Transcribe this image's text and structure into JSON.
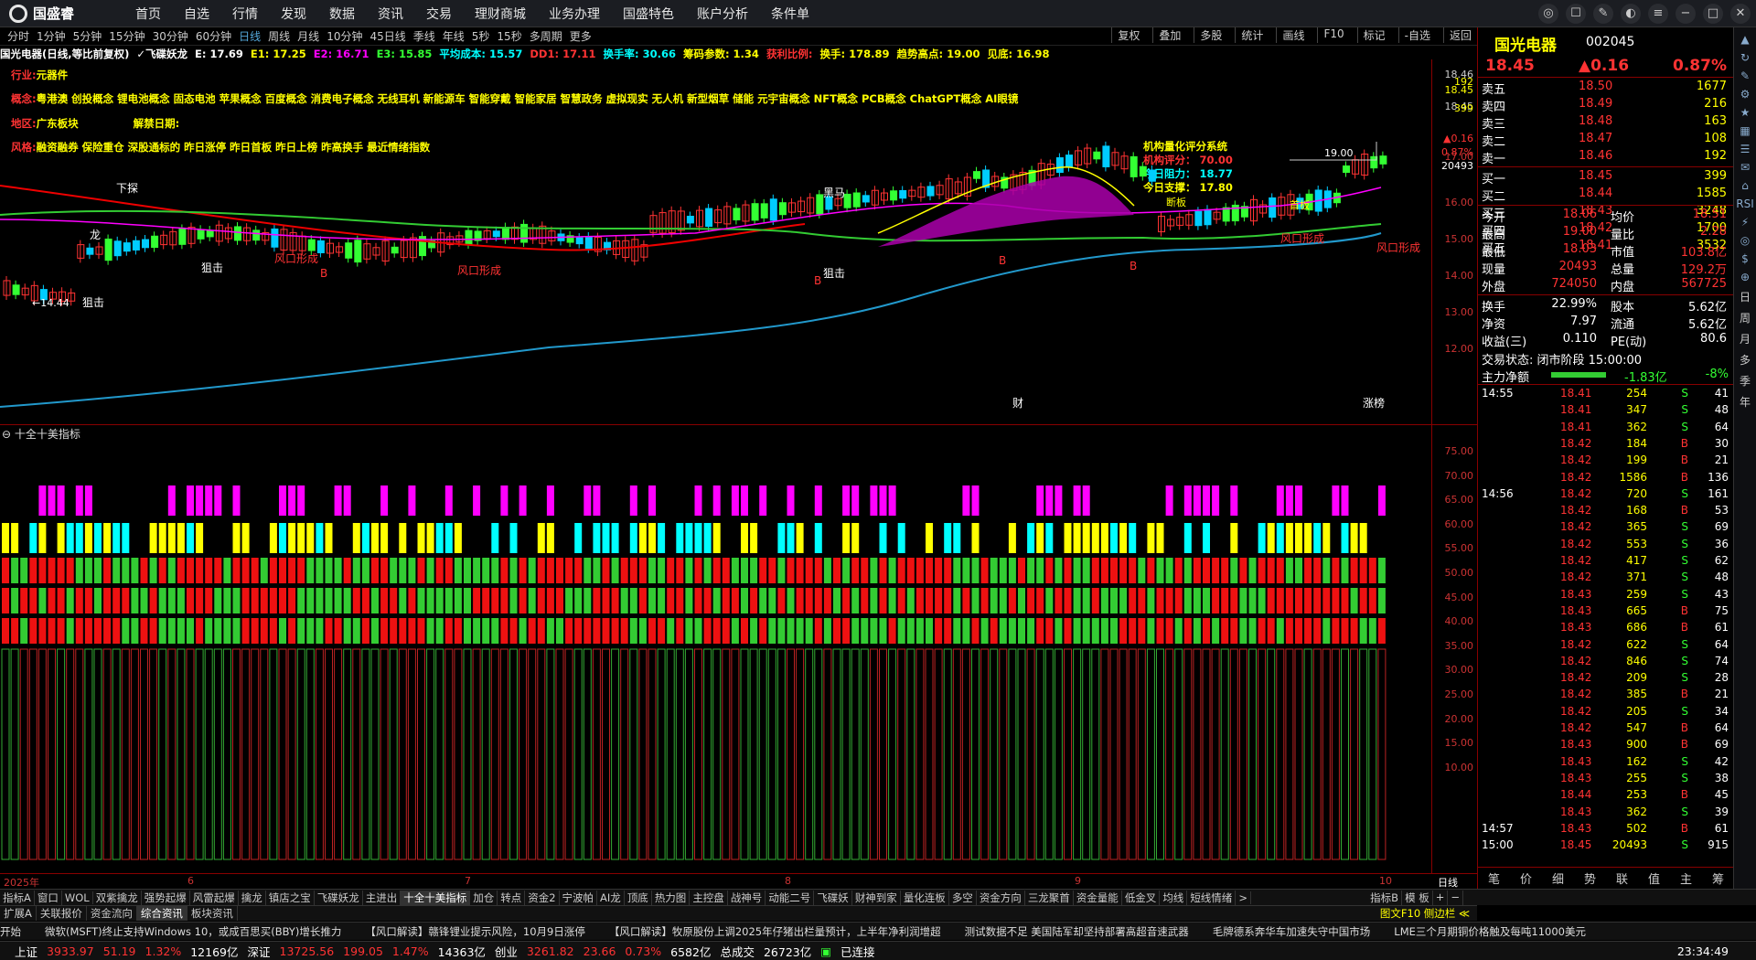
{
  "app": {
    "logo": "国盛睿",
    "menu": [
      "首页",
      "自选",
      "行情",
      "发现",
      "数据",
      "资讯",
      "交易",
      "理财商城",
      "业务办理",
      "国盛特色",
      "账户分析",
      "条件单"
    ]
  },
  "periods": [
    "分时",
    "1分钟",
    "5分钟",
    "15分钟",
    "30分钟",
    "60分钟",
    "日线",
    "周线",
    "月线",
    "10分钟",
    "45日线",
    "季线",
    "年线",
    "5秒",
    "15秒",
    "多周期",
    "更多"
  ],
  "active_period": "日线",
  "chart_tools": [
    "复权",
    "叠加",
    "多股",
    "统计",
    "画线",
    "F10",
    "标记",
    "-自选",
    "返回"
  ],
  "info": [
    {
      "t": "国光电器(日线,等比前复权)",
      "c": "#fff"
    },
    {
      "t": "✓飞碟妖龙",
      "c": "#fff"
    },
    {
      "t": "E: 17.69",
      "c": "#fff"
    },
    {
      "t": "E1: 17.25",
      "c": "#ff0"
    },
    {
      "t": "E2: 16.71",
      "c": "#f0f"
    },
    {
      "t": "E3: 15.85",
      "c": "#3f3"
    },
    {
      "t": "平均成本: 15.57",
      "c": "#0ff"
    },
    {
      "t": "DD1: 17.11",
      "c": "#f33"
    },
    {
      "t": "换手率: 30.66",
      "c": "#0ff"
    },
    {
      "t": "筹码参数: 1.34",
      "c": "#ff0"
    },
    {
      "t": "获利比例:",
      "c": "#f33"
    },
    {
      "t": "换手: 178.89",
      "c": "#ff0"
    },
    {
      "t": "趋势高点: 19.00",
      "c": "#ff0"
    },
    {
      "t": "见底: 16.98",
      "c": "#ff0"
    }
  ],
  "concept": {
    "industry_label": "行业:",
    "industry": "元器件",
    "concept_label": "概念:",
    "concepts": "粤港澳 创投概念 锂电池概念 固态电池 苹果概念 百度概念 消费电子概念 无线耳机 新能源车 智能穿戴 智能家居 智慧政务 虚拟现实 无人机 新型烟草 储能 元宇宙概念 NFT概念 PCB概念 ChatGPT概念 AI眼镜",
    "region_label": "地区:",
    "region": "广东板块",
    "unlock_label": "解禁日期:",
    "style_label": "风格:",
    "styles": "融资融券 保险重仓 深股通标的 昨日涨停 昨日首板 昨日上榜 昨高换手 最近情绪指数"
  },
  "score": {
    "title": "机构量化评分系统",
    "r1": "机构评分： 70.00",
    "r2": "今日阻力： 18.77",
    "r3": "今日支撑： 17.80"
  },
  "chart_labels": {
    "high": "19.00",
    "low": "←14.44",
    "tags": [
      "龙",
      "下探",
      "狙击",
      "黑马",
      "狙击",
      "狙击",
      "风口形成",
      "风口形成",
      "风口形成",
      "风口形成",
      "B",
      "B",
      "B",
      "B",
      "财",
      "涨榜"
    ],
    "annot": [
      "首板",
      "断板"
    ]
  },
  "price_ticks": [
    "18.46",
    "18.45",
    "18.45",
    "17.00",
    "16.00",
    "15.00",
    "14.00",
    "13.00",
    "12.00"
  ],
  "price_side": [
    "192",
    "399",
    "▲0.16",
    "0.87%",
    "20493"
  ],
  "ind_title": "十全十美指标",
  "ind_ticks": [
    "75.00",
    "70.00",
    "65.00",
    "60.00",
    "55.00",
    "50.00",
    "45.00",
    "40.00",
    "35.00",
    "30.00",
    "25.00",
    "20.00",
    "15.00",
    "10.00"
  ],
  "dates": {
    "year": "2025年",
    "m6": "6",
    "m7": "7",
    "m8": "8",
    "m9": "9",
    "m10": "10",
    "period": "日线"
  },
  "tabs1": [
    "指标A",
    "窗口",
    "WOL",
    "双紫擒龙",
    "强势起爆",
    "风雷起爆",
    "擒龙",
    "镇店之宝",
    "飞碟妖龙",
    "主进出",
    "十全十美指标",
    "加仓",
    "转点",
    "资金2",
    "宁波帕",
    "AI龙",
    "顶底",
    "热力图",
    "主控盘",
    "战神号",
    "动能二号",
    "飞碟妖",
    "财神到家",
    "量化连板",
    "多空",
    "资金方向",
    "三龙聚首",
    "资金量能",
    "低金叉",
    "均线",
    "短线情绪",
    ">"
  ],
  "tabs1_right": [
    "指标B",
    "模 板",
    "+",
    "−"
  ],
  "tabs2": [
    "扩展A",
    "关联报价",
    "资金流向",
    "综合资讯",
    "板块资讯"
  ],
  "tabs2_right": "图文F10 侧边栏 ≪",
  "quote": {
    "name": "国光电器",
    "code": "002045",
    "price": "18.45",
    "change": "▲0.16",
    "pct": "0.87%",
    "asks": [
      [
        "卖五",
        "18.50",
        "1677"
      ],
      [
        "卖四",
        "18.49",
        "216"
      ],
      [
        "卖三",
        "18.48",
        "163"
      ],
      [
        "卖二",
        "18.47",
        "108"
      ],
      [
        "卖一",
        "18.46",
        "192"
      ]
    ],
    "bids": [
      [
        "买一",
        "18.45",
        "399"
      ],
      [
        "买二",
        "18.44",
        "1585"
      ],
      [
        "买三",
        "18.43",
        "3248"
      ],
      [
        "买四",
        "18.42",
        "1700"
      ],
      [
        "买五",
        "18.41",
        "3532"
      ]
    ],
    "stats": [
      [
        "今开",
        "18.06",
        "均价",
        "18.51"
      ],
      [
        "最高",
        "19.00",
        "量比",
        "2.28"
      ],
      [
        "最低",
        "18.03",
        "市值",
        "103.8亿"
      ],
      [
        "现量",
        "20493",
        "总量",
        "129.2万"
      ],
      [
        "外盘",
        "724050",
        "内盘",
        "567725"
      ]
    ],
    "stats2": [
      [
        "换手",
        "22.99%",
        "股本",
        "5.62亿"
      ],
      [
        "净资",
        "7.97",
        "流通",
        "5.62亿"
      ],
      [
        "收益(三)",
        "0.110",
        "PE(动)",
        "80.6"
      ]
    ],
    "trade_state": "交易状态: 闭市阶段 15:00:00",
    "netflow_label": "主力净额",
    "netflow": "-1.83亿",
    "netflow_pct": "-8%"
  },
  "ticks": [
    [
      "14:55",
      "18.41",
      "254",
      "S",
      "41"
    ],
    [
      "",
      "18.41",
      "347",
      "S",
      "48"
    ],
    [
      "",
      "18.41",
      "362",
      "S",
      "64"
    ],
    [
      "",
      "18.42",
      "184",
      "B",
      "30"
    ],
    [
      "",
      "18.42",
      "199",
      "B",
      "21"
    ],
    [
      "",
      "18.42",
      "1586",
      "B",
      "136"
    ],
    [
      "14:56",
      "18.42",
      "720",
      "S",
      "161"
    ],
    [
      "",
      "18.42",
      "168",
      "B",
      "53"
    ],
    [
      "",
      "18.42",
      "365",
      "S",
      "69"
    ],
    [
      "",
      "18.42",
      "553",
      "S",
      "36"
    ],
    [
      "",
      "18.42",
      "417",
      "S",
      "62"
    ],
    [
      "",
      "18.42",
      "371",
      "S",
      "48"
    ],
    [
      "",
      "18.43",
      "259",
      "S",
      "43"
    ],
    [
      "",
      "18.43",
      "665",
      "B",
      "75"
    ],
    [
      "",
      "18.43",
      "686",
      "B",
      "61"
    ],
    [
      "",
      "18.42",
      "622",
      "S",
      "64"
    ],
    [
      "",
      "18.42",
      "846",
      "S",
      "74"
    ],
    [
      "",
      "18.42",
      "209",
      "S",
      "28"
    ],
    [
      "",
      "18.42",
      "385",
      "B",
      "21"
    ],
    [
      "",
      "18.42",
      "205",
      "S",
      "34"
    ],
    [
      "",
      "18.42",
      "547",
      "B",
      "64"
    ],
    [
      "",
      "18.43",
      "900",
      "B",
      "69"
    ],
    [
      "",
      "18.43",
      "162",
      "S",
      "42"
    ],
    [
      "",
      "18.43",
      "255",
      "S",
      "38"
    ],
    [
      "",
      "18.44",
      "253",
      "B",
      "45"
    ],
    [
      "",
      "18.43",
      "362",
      "S",
      "39"
    ],
    [
      "14:57",
      "18.43",
      "502",
      "B",
      "61"
    ],
    [
      "15:00",
      "18.45",
      "20493",
      "S",
      "915"
    ]
  ],
  "right_tabs": [
    "笔",
    "价",
    "细",
    "势",
    "联",
    "值",
    "主",
    "筹"
  ],
  "sidenav": [
    "日",
    "周",
    "月",
    "多",
    "季",
    "年"
  ],
  "news": [
    "开始",
    "微软(MSFT)终止支持Windows 10，或成百思买(BBY)增长推力",
    "【风口解读】赣锋锂业提示风险，10月9日涨停",
    "【风口解读】牧原股份上调2025年仔猪出栏量预计，上半年净利润增超",
    "测试数据不足 美国陆军却坚持部署高超音速武器",
    "毛牌德系奔华车加速失守中国市场",
    "LME三个月期铜价格触及每吨11000美元"
  ],
  "status": {
    "sh_label": "上证",
    "sh": "3933.97",
    "sh_chg": "51.19",
    "sh_pct": "1.32%",
    "sh_amt": "12169亿",
    "sz_label": "深证",
    "sz": "13725.56",
    "sz_chg": "199.05",
    "sz_pct": "1.47%",
    "sz_amt": "14363亿",
    "cy_label": "创业",
    "cy": "3261.82",
    "cy_chg": "23.66",
    "cy_pct": "0.73%",
    "cy_amt": "6582亿",
    "total_label": "总成交",
    "total": "26723亿",
    "conn": "已连接",
    "time": "23:34:49"
  }
}
